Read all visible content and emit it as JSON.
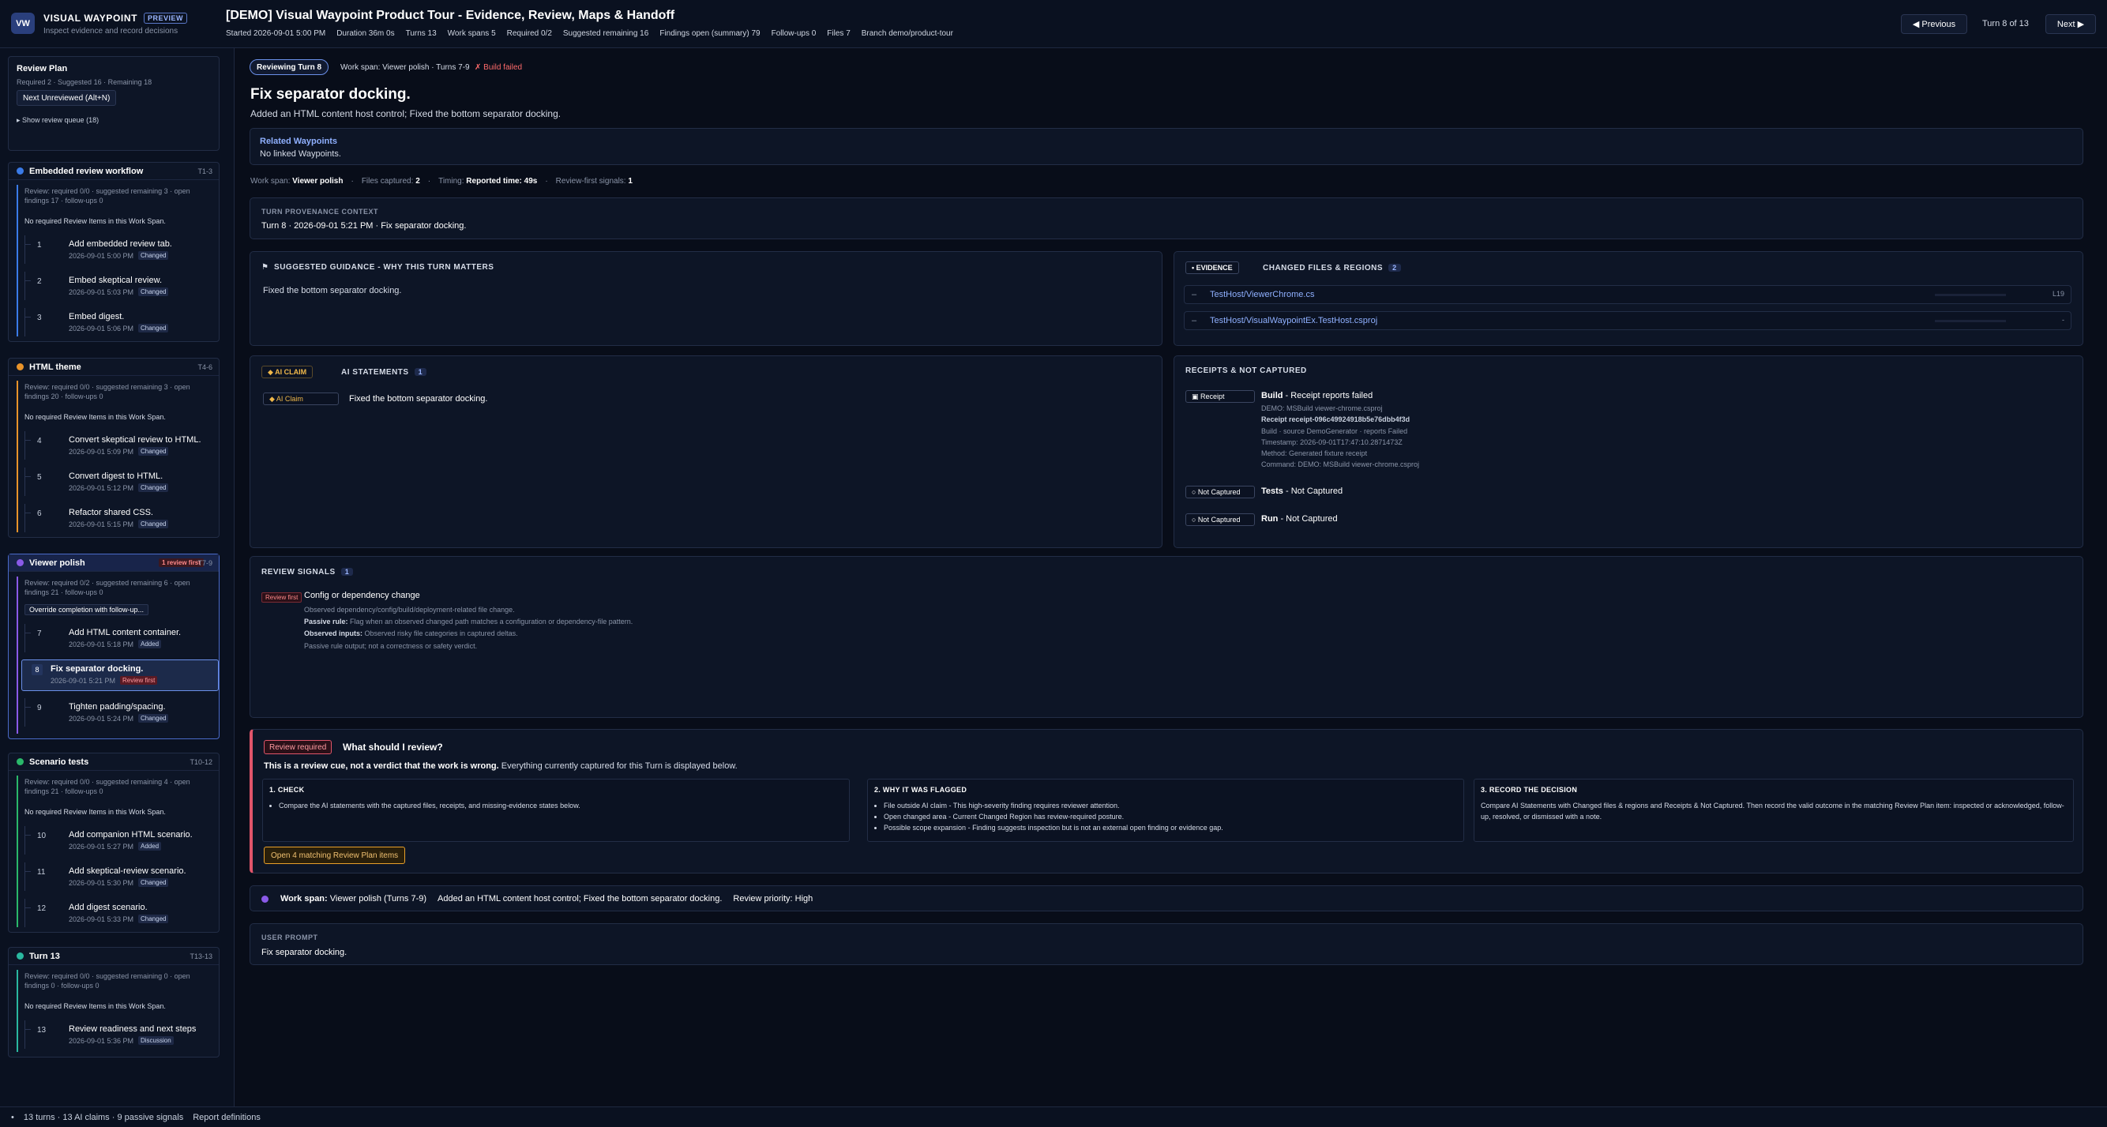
{
  "app": {
    "logo": "VW",
    "brand": "VISUAL WAYPOINT",
    "preview": "PREVIEW",
    "tagline": "Inspect evidence and record decisions"
  },
  "header": {
    "title": "[DEMO] Visual Waypoint Product Tour - Evidence, Review, Maps & Handoff",
    "meta": [
      "Started 2026-09-01 5:00 PM",
      "Duration 36m 0s",
      "Turns 13",
      "Work spans 5",
      "Required 0/2",
      "Suggested remaining 16",
      "Findings open (summary) 79",
      "Follow-ups 0",
      "Files 7",
      "Branch demo/product-tour"
    ],
    "prev": "◀ Previous",
    "turn": "Turn 8 of 13",
    "next": "Next ▶"
  },
  "review_plan": {
    "title": "Review Plan",
    "summary": "Required 2 · Suggested 16 · Remaining 18",
    "next_button": "Next Unreviewed (Alt+N)",
    "show_queue": "▸ Show review queue (18)"
  },
  "groups": [
    {
      "name": "Embedded review workflow",
      "range": "T1-3",
      "color": "#3a7be8",
      "info": "Review: required 0/0 · suggested remaining 3 · open findings 17 · follow-ups 0",
      "none": "No required Review Items in this Work Span.",
      "items": [
        {
          "num": "1",
          "name": "Add embedded review tab.",
          "date": "2026-09-01 5:00 PM",
          "badge": "Changed"
        },
        {
          "num": "2",
          "name": "Embed skeptical review.",
          "date": "2026-09-01 5:03 PM",
          "badge": "Changed"
        },
        {
          "num": "3",
          "name": "Embed digest.",
          "date": "2026-09-01 5:06 PM",
          "badge": "Changed"
        }
      ]
    },
    {
      "name": "HTML theme",
      "range": "T4-6",
      "color": "#e8932a",
      "info": "Review: required 0/0 · suggested remaining 3 · open findings 20 · follow-ups 0",
      "none": "No required Review Items in this Work Span.",
      "items": [
        {
          "num": "4",
          "name": "Convert skeptical review to HTML.",
          "date": "2026-09-01 5:09 PM",
          "badge": "Changed"
        },
        {
          "num": "5",
          "name": "Convert digest to HTML.",
          "date": "2026-09-01 5:12 PM",
          "badge": "Changed"
        },
        {
          "num": "6",
          "name": "Refactor shared CSS.",
          "date": "2026-09-01 5:15 PM",
          "badge": "Changed"
        }
      ]
    },
    {
      "name": "Viewer polish",
      "range": "T7-9",
      "color": "#8a5ae8",
      "badge": "1 review first",
      "info": "Review: required 0/2 · suggested remaining 6 · open findings 21 · follow-ups 0",
      "override": "Override completion with follow-up...",
      "items": [
        {
          "num": "7",
          "name": "Add HTML content container.",
          "date": "2026-09-01 5:18 PM",
          "badge": "Added"
        },
        {
          "num": "8",
          "name": "Fix separator docking.",
          "date": "2026-09-01 5:21 PM",
          "badge": "Review first"
        },
        {
          "num": "9",
          "name": "Tighten padding/spacing.",
          "date": "2026-09-01 5:24 PM",
          "badge": "Changed"
        }
      ]
    },
    {
      "name": "Scenario tests",
      "range": "T10-12",
      "color": "#2ab86a",
      "info": "Review: required 0/0 · suggested remaining 4 · open findings 21 · follow-ups 0",
      "none": "No required Review Items in this Work Span.",
      "items": [
        {
          "num": "10",
          "name": "Add companion HTML scenario.",
          "date": "2026-09-01 5:27 PM",
          "badge": "Added"
        },
        {
          "num": "11",
          "name": "Add skeptical-review scenario.",
          "date": "2026-09-01 5:30 PM",
          "badge": "Changed"
        },
        {
          "num": "12",
          "name": "Add digest scenario.",
          "date": "2026-09-01 5:33 PM",
          "badge": "Changed"
        }
      ]
    },
    {
      "name": "Turn 13",
      "range": "T13-13",
      "color": "#2ab8a0",
      "info": "Review: required 0/0 · suggested remaining 0 · open findings 0 · follow-ups 0",
      "none": "No required Review Items in this Work Span.",
      "items": [
        {
          "num": "13",
          "name": "Review readiness and next steps",
          "date": "2026-09-01 5:36 PM",
          "badge": "Discussion"
        }
      ]
    }
  ],
  "footer": {
    "bullet": "•",
    "text": "13 turns · 13 AI claims · 9 passive signals",
    "link": "Report definitions"
  },
  "main": {
    "pill": "Reviewing Turn 8",
    "workspan": "Work span: Viewer polish · Turns 7-9",
    "build_failed": "✗ Build failed",
    "heading": "Fix separator docking.",
    "subtitle": "Added an HTML content host control; Fixed the bottom separator docking.",
    "related": {
      "title": "Related Waypoints",
      "text": "No linked Waypoints."
    },
    "ws_meta": {
      "ws_label": "Work span:",
      "ws_value": "Viewer polish",
      "files_label": "Files captured:",
      "files_value": "2",
      "timing_label": "Timing:",
      "timing_value": "Reported time: 49s",
      "signals_label": "Review-first signals:",
      "signals_value": "1"
    },
    "provenance": {
      "title": "TURN PROVENANCE CONTEXT",
      "value": "Turn 8 · 2026-09-01 5:21 PM · Fix separator docking."
    },
    "guidance": {
      "title": "SUGGESTED GUIDANCE - WHY THIS TURN MATTERS",
      "text": "Fixed the bottom separator docking."
    },
    "evidence": {
      "tag": "• EVIDENCE",
      "title": "CHANGED FILES & REGIONS",
      "count": "2",
      "files": [
        {
          "mark": "–",
          "name": "TestHost/ViewerChrome.cs",
          "line": "L19"
        },
        {
          "mark": "–",
          "name": "TestHost/VisualWaypointEx.TestHost.csproj",
          "line": "-"
        }
      ]
    },
    "claims": {
      "tag": "◆ AI CLAIM",
      "title": "AI STATEMENTS",
      "count": "1",
      "item_tag": "◆ AI Claim",
      "item_text": "Fixed the bottom separator docking."
    },
    "receipts": {
      "title": "RECEIPTS & NOT CAPTURED",
      "build": {
        "tag": "▣ Receipt",
        "title_b": "Build",
        "title_rest": " - Receipt reports failed",
        "lines": [
          "DEMO: MSBuild viewer-chrome.csproj"
        ],
        "receipt_id": "Receipt receipt-096c49924918b5e76dbb4f3d",
        "details": [
          "Build · source DemoGenerator · reports Failed",
          "Timestamp: 2026-09-01T17:47:10.2871473Z",
          "Method: Generated fixture receipt",
          "Command: DEMO: MSBuild viewer-chrome.csproj"
        ]
      },
      "tests": {
        "tag": "○ Not Captured",
        "title_b": "Tests",
        "title_rest": " - Not Captured"
      },
      "run": {
        "tag": "○ Not Captured",
        "title_b": "Run",
        "title_rest": " - Not Captured"
      }
    },
    "signals": {
      "title": "REVIEW SIGNALS",
      "count": "1",
      "tag": "Review first",
      "name": "Config or dependency change",
      "desc": "Observed dependency/config/build/deployment-related file change.",
      "rule_label": "Passive rule:",
      "rule": " Flag when an observed changed path matches a configuration or dependency-file pattern.",
      "inputs_label": "Observed inputs:",
      "inputs": " Observed risky file categories in captured deltas.",
      "note": "Passive rule output; not a correctness or safety verdict."
    },
    "review_required": {
      "tag": "Review required",
      "title": "What should I review?",
      "lead_b": "This is a review cue, not a verdict that the work is wrong.",
      "lead_rest": " Everything currently captured for this Turn is displayed below.",
      "check": {
        "title": "1. CHECK",
        "items": [
          "Compare the AI statements with the captured files, receipts, and missing-evidence states below."
        ]
      },
      "why": {
        "title": "2. WHY IT WAS FLAGGED",
        "items": [
          "File outside AI claim - This high-severity finding requires reviewer attention.",
          "Open changed area - Current Changed Region has review-required posture.",
          "Possible scope expansion - Finding suggests inspection but is not an external open finding or evidence gap."
        ]
      },
      "record": {
        "title": "3. RECORD THE DECISION",
        "text": "Compare AI Statements with Changed files & regions and Receipts & Not Captured. Then record the valid outcome in the matching Review Plan item: inspected or acknowledged, follow-up, resolved, or dismissed with a note."
      },
      "open_button": "Open 4 matching Review Plan items"
    },
    "workspan_bar": {
      "label": "Work span:",
      "value": " Viewer polish (Turns 7-9)",
      "desc": "Added an HTML content host control; Fixed the bottom separator docking.",
      "priority": "Review priority: High"
    },
    "prompt": {
      "title": "USER PROMPT",
      "text": "Fix separator docking."
    }
  },
  "colors": {
    "accent": "#6a8fe8",
    "danger": "#e0556a",
    "warning": "#e8a02a"
  }
}
